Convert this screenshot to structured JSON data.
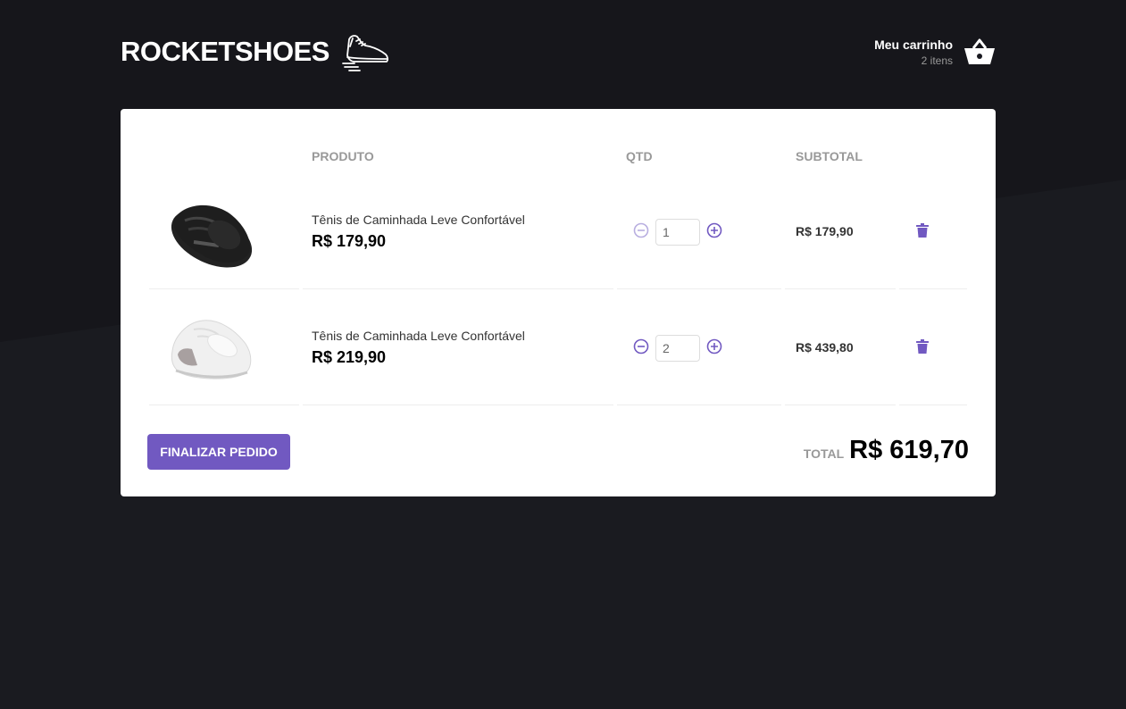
{
  "header": {
    "logo_text": "ROCKETSHOES",
    "cart_title": "Meu carrinho",
    "cart_count": "2 itens"
  },
  "table": {
    "headers": [
      "PRODUTO",
      "QTD",
      "SUBTOTAL"
    ],
    "rows": [
      {
        "name": "Tênis de Caminhada Leve Confortável",
        "price": "R$ 179,90",
        "quantity": "1",
        "subtotal": "R$ 179,90",
        "shoe_color": "#1e1e1e"
      },
      {
        "name": "Tênis de Caminhada Leve Confortável",
        "price": "R$ 219,90",
        "quantity": "2",
        "subtotal": "R$ 439,80",
        "shoe_color": "#f2f2f2"
      }
    ]
  },
  "footer": {
    "checkout_label": "FINALIZAR PEDIDO",
    "total_label": "TOTAL",
    "total_value": "R$ 619,70"
  },
  "colors": {
    "accent": "#7159c1",
    "background": "#191920"
  }
}
